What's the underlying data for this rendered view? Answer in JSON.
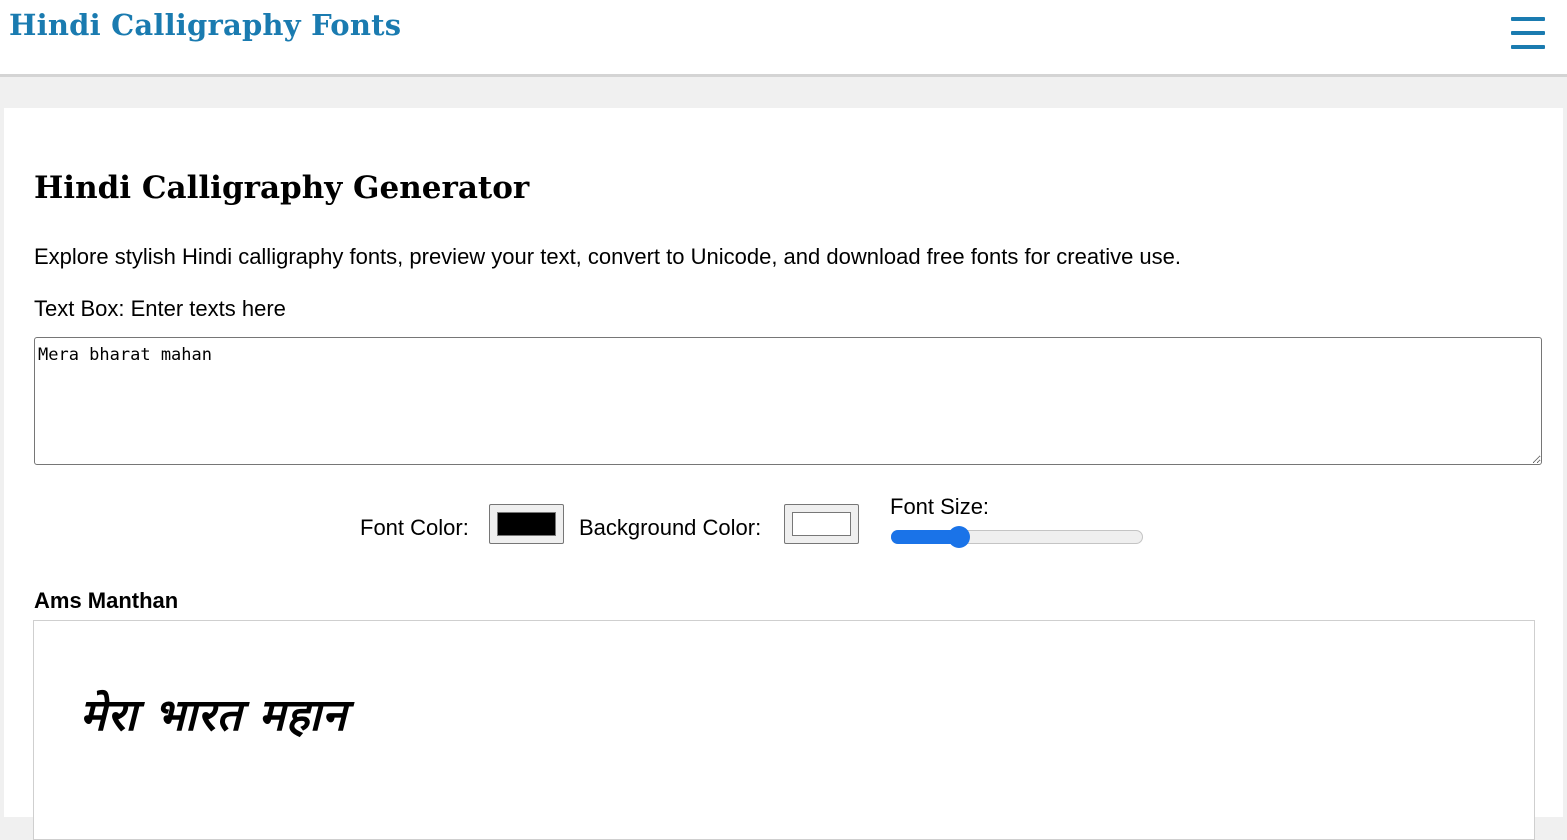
{
  "header": {
    "site_title": "Hindi Calligraphy Fonts",
    "menu_icon": "hamburger-menu-icon",
    "title_color": "#1a7bb0"
  },
  "main": {
    "title": "Hindi Calligraphy Generator",
    "intro": "Explore stylish Hindi calligraphy fonts, preview your text, convert to Unicode, and download free fonts for creative use.",
    "textbox_label": "Text Box: Enter texts here",
    "textbox_value": "Mera bharat mahan"
  },
  "controls": {
    "font_color_label": "Font Color:",
    "font_color_value": "#000000",
    "background_color_label": "Background Color:",
    "background_color_value": "#ffffff",
    "font_size_label": "Font Size:",
    "font_size_fraction": 0.27,
    "accent_color": "#1a73e8"
  },
  "preview": {
    "font_name": "Ams Manthan",
    "text": "मेरा भारत महान"
  }
}
